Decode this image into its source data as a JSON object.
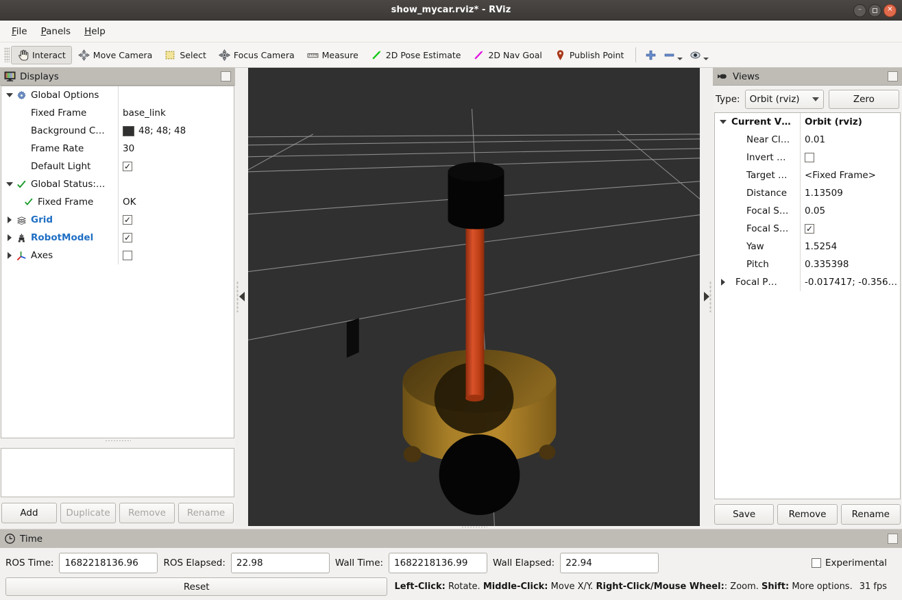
{
  "window": {
    "title": "show_mycar.rviz* - RViz",
    "controls": {
      "minimize": "minimize-button",
      "maximize": "maximize-button",
      "close": "close-button"
    }
  },
  "menubar": {
    "items": [
      "File",
      "Panels",
      "Help"
    ]
  },
  "toolbar": {
    "items": [
      {
        "label": "Interact",
        "icon": "hand-cursor-icon",
        "active": true
      },
      {
        "label": "Move Camera",
        "icon": "move-camera-icon",
        "active": false
      },
      {
        "label": "Select",
        "icon": "select-rectangle-icon",
        "active": false
      },
      {
        "label": "Focus Camera",
        "icon": "focus-camera-icon",
        "active": false
      },
      {
        "label": "Measure",
        "icon": "ruler-icon",
        "active": false
      },
      {
        "label": "2D Pose Estimate",
        "icon": "green-arrow-icon",
        "active": false
      },
      {
        "label": "2D Nav Goal",
        "icon": "magenta-arrow-icon",
        "active": false
      },
      {
        "label": "Publish Point",
        "icon": "map-pin-icon",
        "active": false
      }
    ],
    "extras": [
      {
        "icon": "plus-icon",
        "name": "add-tool-button"
      },
      {
        "icon": "minus-icon",
        "name": "remove-tool-button"
      },
      {
        "icon": "eye-icon",
        "name": "visibility-button"
      }
    ]
  },
  "displays": {
    "panel_title": "Displays",
    "rows": [
      {
        "name": "Global Options",
        "value": "",
        "indent": 0,
        "twisty": "down",
        "icon": "gear-icon",
        "bold": false,
        "blue": false,
        "value_type": "none"
      },
      {
        "name": "Fixed Frame",
        "value": "base_link",
        "indent": 1,
        "twisty": "none",
        "icon": "none",
        "value_type": "text"
      },
      {
        "name": "Background C…",
        "value": "48; 48; 48",
        "indent": 1,
        "twisty": "none",
        "icon": "none",
        "value_type": "color",
        "color": "#303030"
      },
      {
        "name": "Frame Rate",
        "value": "30",
        "indent": 1,
        "twisty": "none",
        "icon": "none",
        "value_type": "text"
      },
      {
        "name": "Default Light",
        "value": "",
        "indent": 1,
        "twisty": "none",
        "icon": "none",
        "value_type": "checkbox",
        "checked": true
      },
      {
        "name": "Global Status:…",
        "value": "",
        "indent": 0,
        "twisty": "down",
        "icon": "green-check-icon",
        "value_type": "none"
      },
      {
        "name": "Fixed Frame",
        "value": "OK",
        "indent": 1,
        "twisty": "none",
        "icon": "green-check-icon",
        "value_type": "text"
      },
      {
        "name": "Grid",
        "value": "",
        "indent": 0,
        "twisty": "right",
        "icon": "grid-icon",
        "blue": true,
        "value_type": "checkbox",
        "checked": true
      },
      {
        "name": "RobotModel",
        "value": "",
        "indent": 0,
        "twisty": "right",
        "icon": "robot-icon",
        "blue": true,
        "value_type": "checkbox",
        "checked": true
      },
      {
        "name": "Axes",
        "value": "",
        "indent": 0,
        "twisty": "right",
        "icon": "axes-icon",
        "blue": false,
        "value_type": "checkbox",
        "checked": false
      }
    ],
    "description": "",
    "buttons": [
      {
        "label": "Add",
        "enabled": true
      },
      {
        "label": "Duplicate",
        "enabled": false
      },
      {
        "label": "Remove",
        "enabled": false
      },
      {
        "label": "Rename",
        "enabled": false
      }
    ]
  },
  "views": {
    "panel_title": "Views",
    "type_label": "Type:",
    "type_value": "Orbit (rviz)",
    "zero_label": "Zero",
    "rows": [
      {
        "name": "Current V…",
        "value": "Orbit (rviz)",
        "indent": 0,
        "twisty": "down",
        "bold": true,
        "value_type": "text"
      },
      {
        "name": "Near Cl…",
        "value": "0.01",
        "indent": 1,
        "twisty": "none",
        "value_type": "text"
      },
      {
        "name": "Invert …",
        "value": "",
        "indent": 1,
        "twisty": "none",
        "value_type": "checkbox",
        "checked": false
      },
      {
        "name": "Target …",
        "value": "<Fixed Frame>",
        "indent": 1,
        "twisty": "none",
        "value_type": "text"
      },
      {
        "name": "Distance",
        "value": "1.13509",
        "indent": 1,
        "twisty": "none",
        "value_type": "text"
      },
      {
        "name": "Focal S…",
        "value": "0.05",
        "indent": 1,
        "twisty": "none",
        "value_type": "text"
      },
      {
        "name": "Focal S…",
        "value": "",
        "indent": 1,
        "twisty": "none",
        "value_type": "checkbox",
        "checked": true
      },
      {
        "name": "Yaw",
        "value": "1.5254",
        "indent": 1,
        "twisty": "none",
        "value_type": "text"
      },
      {
        "name": "Pitch",
        "value": "0.335398",
        "indent": 1,
        "twisty": "none",
        "value_type": "text"
      },
      {
        "name": "Focal P…",
        "value": "-0.017417; -0.356…",
        "indent": 1,
        "twisty": "right",
        "value_type": "text"
      }
    ],
    "buttons": [
      {
        "label": "Save",
        "enabled": true
      },
      {
        "label": "Remove",
        "enabled": true
      },
      {
        "label": "Rename",
        "enabled": true
      }
    ]
  },
  "time": {
    "panel_title": "Time",
    "fields": [
      {
        "label": "ROS Time:",
        "value": "1682218136.96"
      },
      {
        "label": "ROS Elapsed:",
        "value": "22.98"
      },
      {
        "label": "Wall Time:",
        "value": "1682218136.99"
      },
      {
        "label": "Wall Elapsed:",
        "value": "22.94"
      }
    ],
    "experimental_label": "Experimental",
    "experimental_checked": false,
    "reset_label": "Reset",
    "hint": {
      "k1": "Left-Click:",
      "t1": " Rotate. ",
      "k2": "Middle-Click:",
      "t2": " Move X/Y. ",
      "k3": "Right-Click/Mouse Wheel:",
      "t3": ": Zoom. ",
      "k4": "Shift:",
      "t4": " More options."
    },
    "fps": "31 fps"
  },
  "viewport": {
    "background_color": "#303030",
    "grid_color": "#a8a8a8",
    "robot": {
      "base_color": "#9a7526",
      "mast_color": "#c33f16",
      "sensor_color": "#050505"
    }
  }
}
